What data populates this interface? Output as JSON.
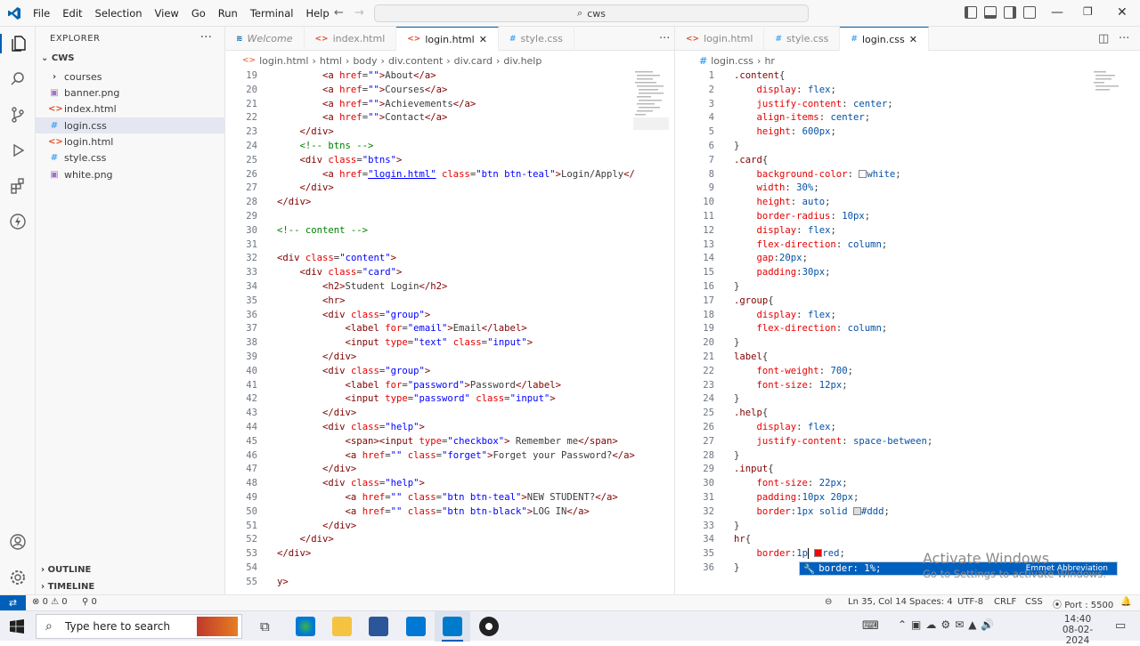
{
  "menu": [
    "File",
    "Edit",
    "Selection",
    "View",
    "Go",
    "Run",
    "Terminal",
    "Help"
  ],
  "search": {
    "text": "cws"
  },
  "explorer": {
    "title": "EXPLORER",
    "folder": "CWS",
    "files": [
      {
        "name": "courses",
        "icon": "›",
        "kind": "folder"
      },
      {
        "name": "banner.png",
        "icon": "▣",
        "kind": "image"
      },
      {
        "name": "index.html",
        "icon": "<>",
        "kind": "html"
      },
      {
        "name": "login.css",
        "icon": "#",
        "kind": "css"
      },
      {
        "name": "login.html",
        "icon": "<>",
        "kind": "html"
      },
      {
        "name": "style.css",
        "icon": "#",
        "kind": "css"
      },
      {
        "name": "white.png",
        "icon": "▣",
        "kind": "image"
      }
    ],
    "outline": "OUTLINE",
    "timeline": "TIMELINE"
  },
  "left_tabs": [
    {
      "label": "Welcome",
      "icon": "≋"
    },
    {
      "label": "index.html",
      "icon": "<>"
    },
    {
      "label": "login.html",
      "icon": "<>",
      "close": "✕"
    },
    {
      "label": "style.css",
      "icon": "#"
    }
  ],
  "right_tabs": [
    {
      "label": "login.html",
      "icon": "<>"
    },
    {
      "label": "style.css",
      "icon": "#"
    },
    {
      "label": "login.css",
      "icon": "#",
      "close": "✕"
    }
  ],
  "left_breadcrumb": [
    "login.html",
    "html",
    "body",
    "div.content",
    "div.card",
    "div.help"
  ],
  "right_breadcrumb": [
    "login.css",
    "hr"
  ],
  "left_lines": {
    "start": 19,
    "current": 48
  },
  "right_lines": {
    "start": 1,
    "current": 35
  },
  "autocomplete": {
    "item": "border: 1%;",
    "hint": "Emmet Abbreviation"
  },
  "watermark": {
    "line1": "Activate Windows",
    "line2": "Go to Settings to activate Windows."
  },
  "status": {
    "errors": "0",
    "warnings": "0",
    "ports": "0",
    "position": "Ln 35, Col 14",
    "spaces": "Spaces: 4",
    "encoding": "UTF-8",
    "eol": "CRLF",
    "lang": "CSS",
    "port": "Port : 5500"
  },
  "taskbar": {
    "search": "Type here to search",
    "time": "14:40",
    "date": "08-02-2024"
  },
  "colors": {
    "accent": "#005fb8",
    "tag": "#800000",
    "attr": "#e50000",
    "string": "#0000ff",
    "comment": "#008000"
  }
}
